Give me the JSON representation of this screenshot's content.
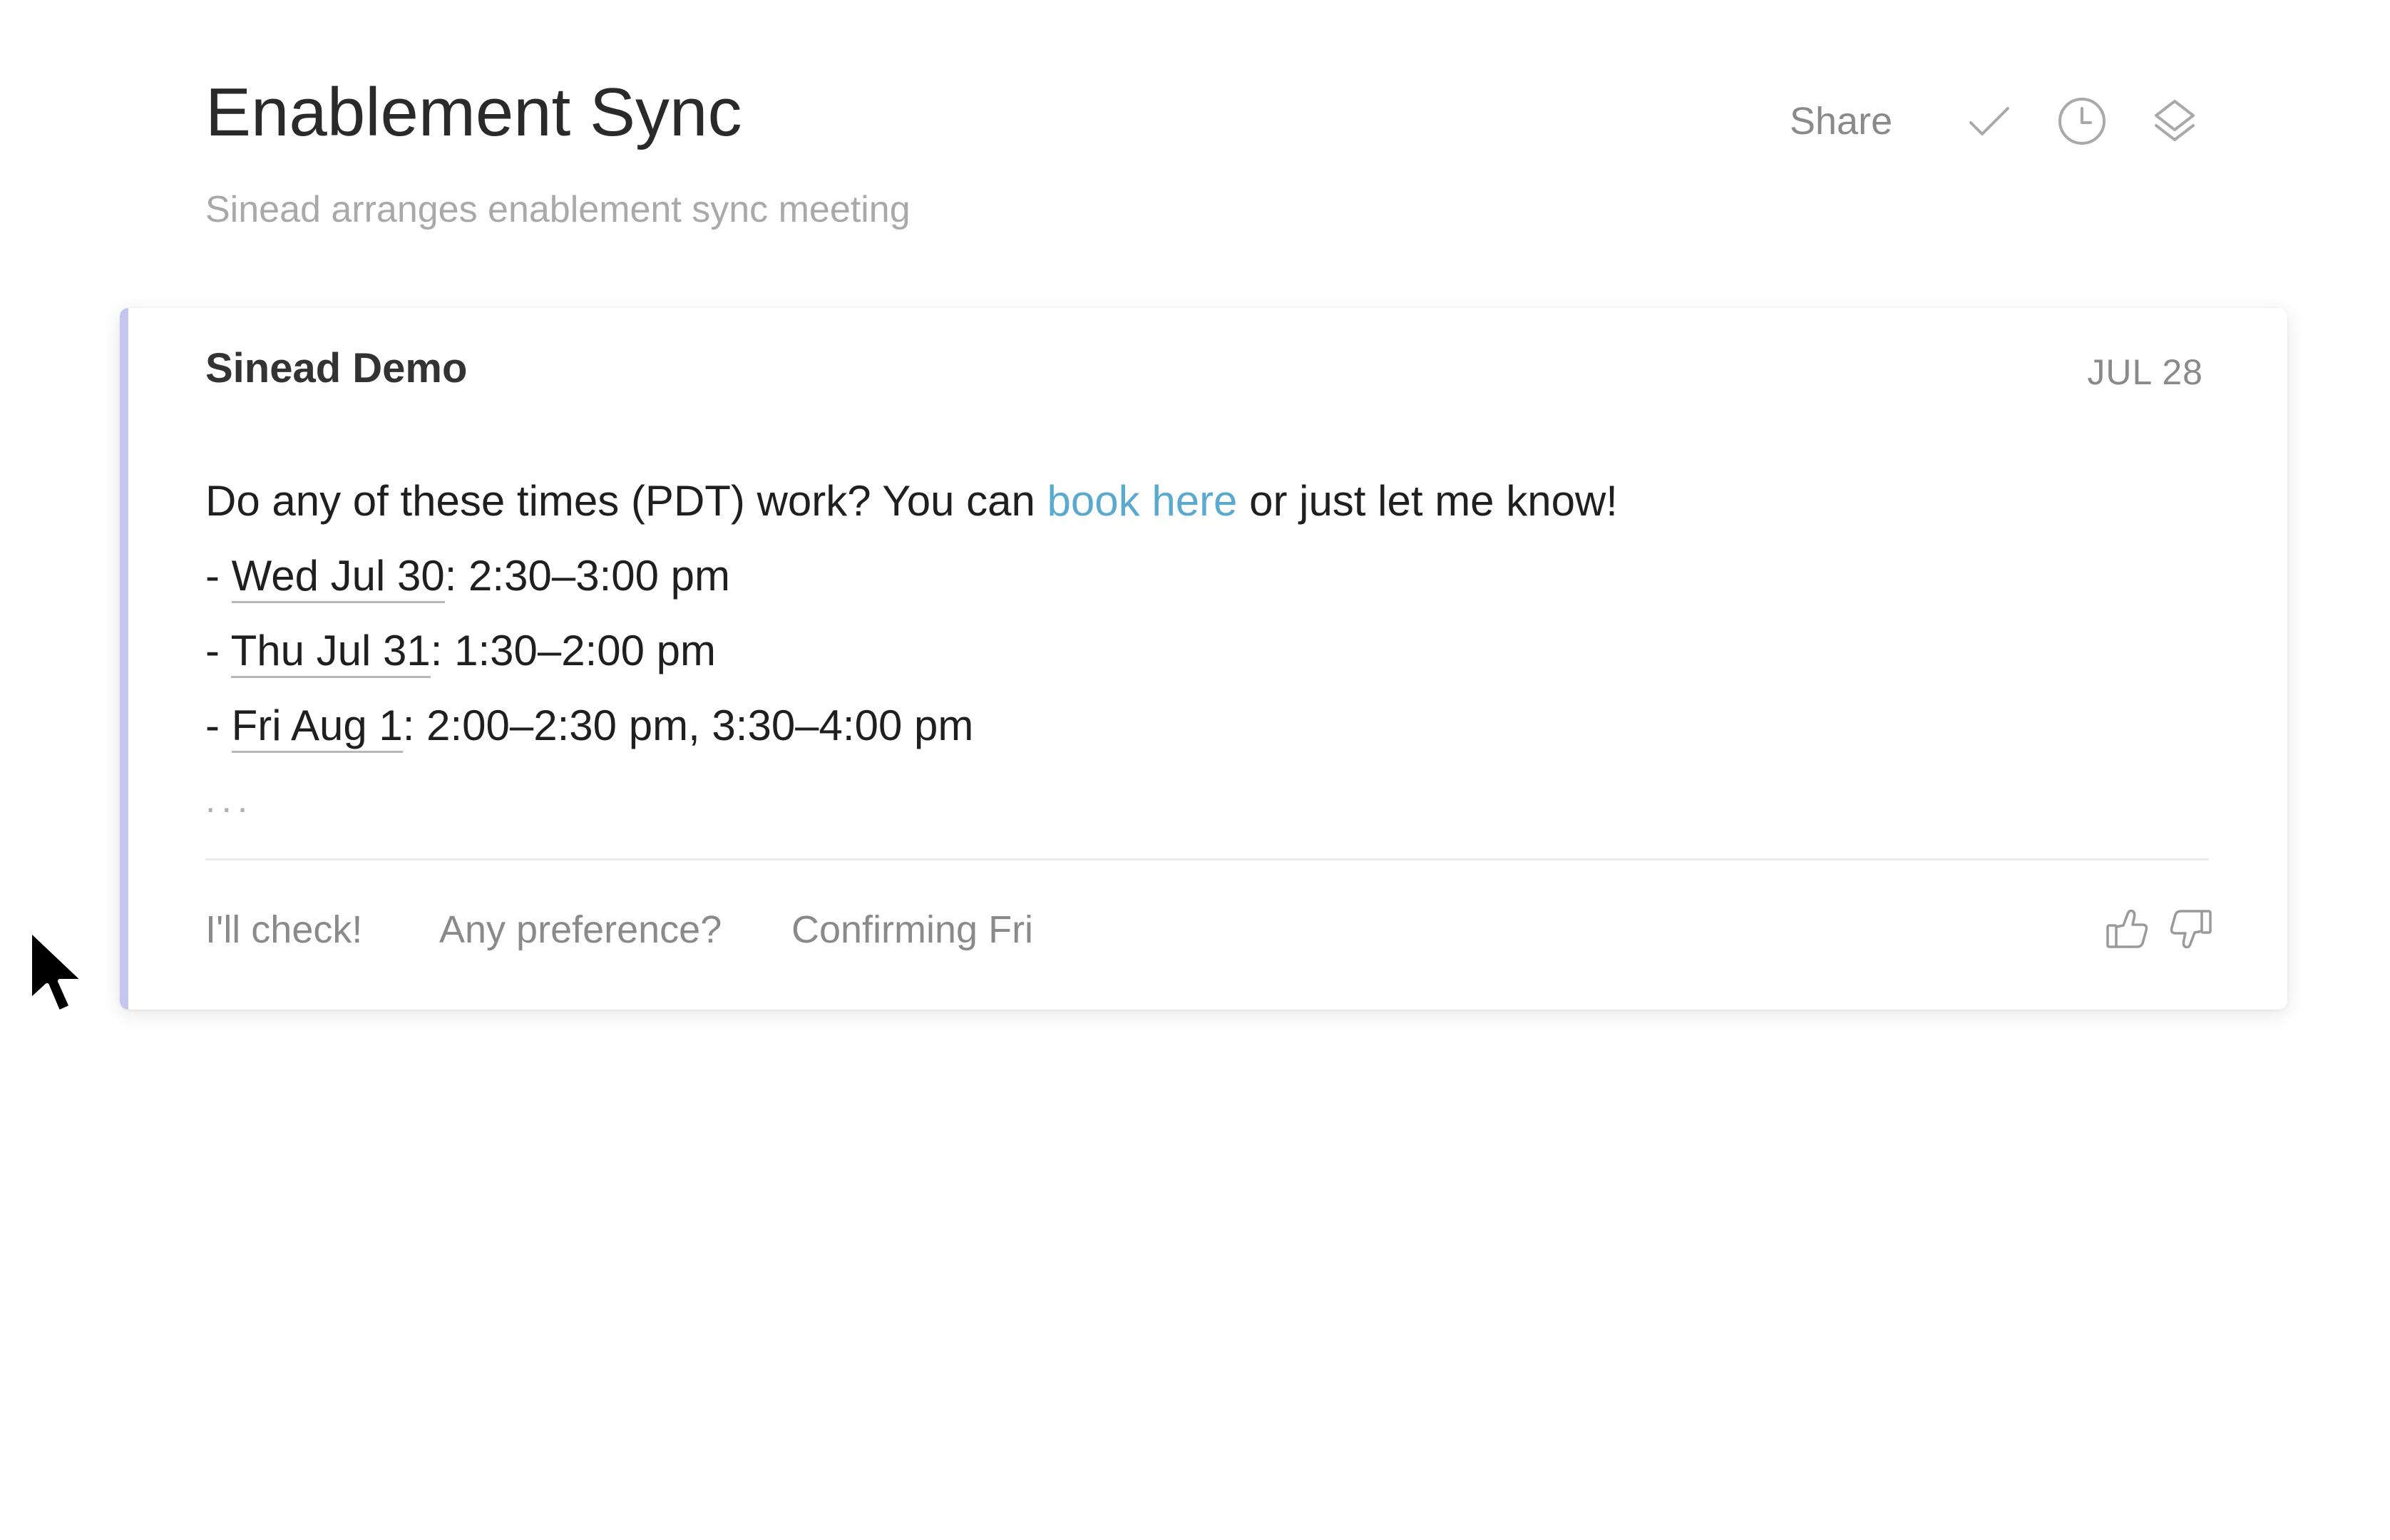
{
  "header": {
    "title": "Enablement Sync",
    "subtitle": "Sinead arranges enablement sync meeting",
    "share_label": "Share",
    "icons": [
      "checkmark-icon",
      "clock-icon",
      "layers-icon"
    ]
  },
  "message": {
    "sender": "Sinead Demo",
    "date": "JUL 28",
    "intro_before_link": "Do any of these times (PDT) work? You can ",
    "link_text": "book here",
    "intro_after_link": " or just let me know!",
    "slots": [
      {
        "prefix": "- ",
        "day": "Wed Jul 30",
        "times": ": 2:30–3:00 pm"
      },
      {
        "prefix": "- ",
        "day": "Thu Jul 31",
        "times": ": 1:30–2:00 pm"
      },
      {
        "prefix": "- ",
        "day": "Fri Aug 1",
        "times": ": 2:00–2:30 pm, 3:30–4:00 pm"
      }
    ],
    "more": "...",
    "accent_color": "#c5c6ee",
    "link_color": "#5aa9cf"
  },
  "quick_replies": [
    {
      "label": "I'll check!"
    },
    {
      "label": "Any preference?"
    },
    {
      "label": "Confirming Fri"
    }
  ],
  "feedback": {
    "icons": [
      "thumbs-up-icon",
      "thumbs-down-icon"
    ]
  }
}
